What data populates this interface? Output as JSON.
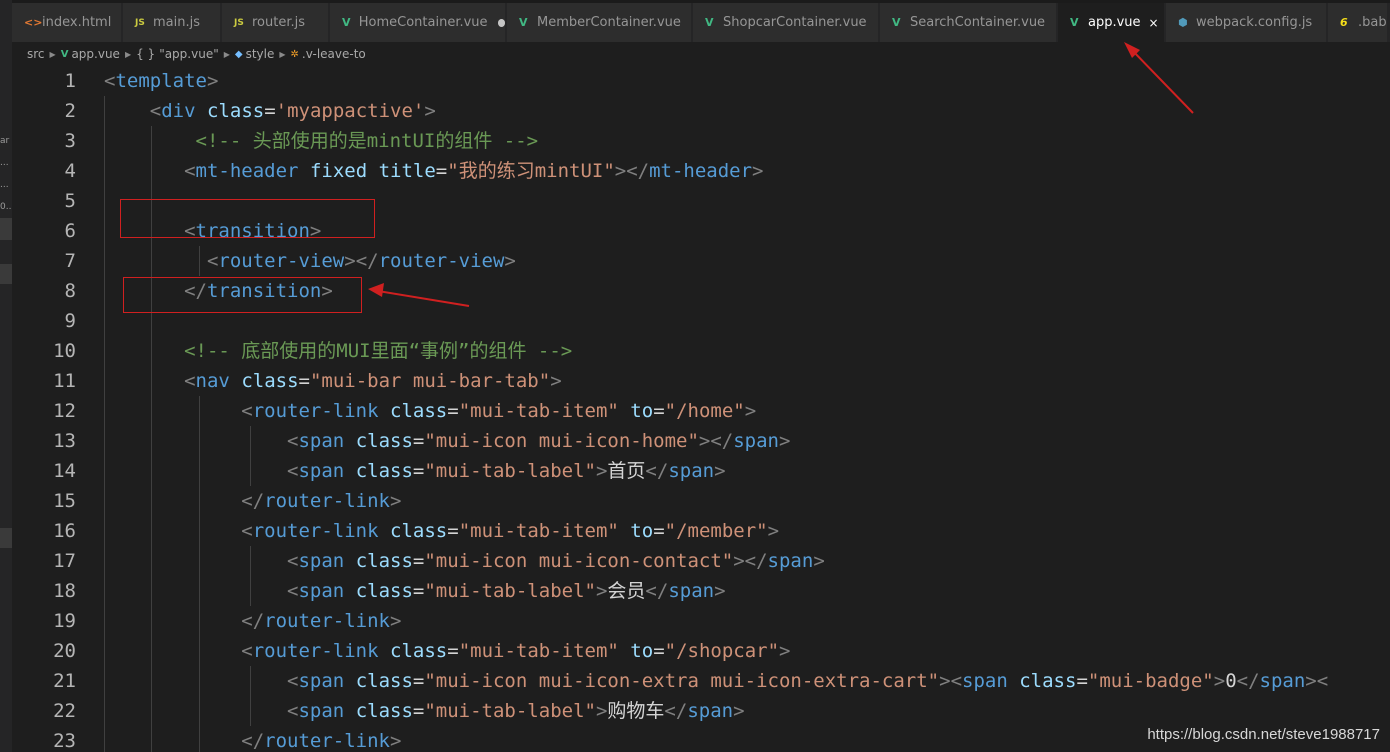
{
  "tabs": [
    {
      "label": "index.html",
      "icon": "html-icon",
      "state": "close"
    },
    {
      "label": "main.js",
      "icon": "js-icon",
      "state": ""
    },
    {
      "label": "router.js",
      "icon": "js-icon",
      "state": ""
    },
    {
      "label": "HomeContainer.vue",
      "icon": "vue-icon",
      "state": "dirty"
    },
    {
      "label": "MemberContainer.vue",
      "icon": "vue-icon",
      "state": ""
    },
    {
      "label": "ShopcarContainer.vue",
      "icon": "vue-icon",
      "state": ""
    },
    {
      "label": "SearchContainer.vue",
      "icon": "vue-icon",
      "state": ""
    },
    {
      "label": "app.vue",
      "icon": "vue-icon",
      "state": "active"
    },
    {
      "label": "webpack.config.js",
      "icon": "webpack-icon",
      "state": ""
    },
    {
      "label": ".bab",
      "icon": "babel-icon",
      "state": ""
    }
  ],
  "tab_glyphs": {
    "close": "×",
    "js": "JS",
    "html": "<>",
    "vue": "V",
    "webpack": "⬢",
    "babel": "6"
  },
  "breadcrumb": {
    "folder": "src",
    "file": "app.vue",
    "braces": "{ }",
    "module": "\"app.vue\"",
    "section": "style",
    "selector": ".v-leave-to",
    "sep": "▶"
  },
  "sidebar_fragments": [
    "ar",
    "...",
    "...",
    "0..."
  ],
  "code_lines": [
    {
      "n": "1",
      "tokens": [
        [
          "ang",
          "<"
        ],
        [
          "tag",
          "template"
        ],
        [
          "ang",
          ">"
        ]
      ]
    },
    {
      "n": "2",
      "tokens": [
        [
          "txt",
          "    "
        ],
        [
          "ang",
          "<"
        ],
        [
          "tag",
          "div"
        ],
        [
          "txt",
          " "
        ],
        [
          "attr",
          "class"
        ],
        [
          "eq",
          "="
        ],
        [
          "str",
          "'myappactive'"
        ],
        [
          "ang",
          ">"
        ]
      ]
    },
    {
      "n": "3",
      "tokens": [
        [
          "txt",
          "        "
        ],
        [
          "cmt",
          "<!-- 头部使用的是mintUI的组件 -->"
        ]
      ]
    },
    {
      "n": "4",
      "tokens": [
        [
          "txt",
          "       "
        ],
        [
          "ang",
          "<"
        ],
        [
          "tag",
          "mt-header"
        ],
        [
          "txt",
          " "
        ],
        [
          "attr",
          "fixed"
        ],
        [
          "txt",
          " "
        ],
        [
          "attr",
          "title"
        ],
        [
          "eq",
          "="
        ],
        [
          "str",
          "\"我的练习mintUI\""
        ],
        [
          "ang",
          "></"
        ],
        [
          "tag",
          "mt-header"
        ],
        [
          "ang",
          ">"
        ]
      ]
    },
    {
      "n": "5",
      "tokens": []
    },
    {
      "n": "6",
      "tokens": [
        [
          "txt",
          "       "
        ],
        [
          "ang",
          "<"
        ],
        [
          "tag",
          "transition"
        ],
        [
          "ang",
          ">"
        ]
      ]
    },
    {
      "n": "7",
      "tokens": [
        [
          "txt",
          "         "
        ],
        [
          "ang",
          "<"
        ],
        [
          "tag",
          "router-view"
        ],
        [
          "ang",
          "></"
        ],
        [
          "tag",
          "router-view"
        ],
        [
          "ang",
          ">"
        ]
      ]
    },
    {
      "n": "8",
      "tokens": [
        [
          "txt",
          "       "
        ],
        [
          "ang",
          "</"
        ],
        [
          "tag",
          "transition"
        ],
        [
          "ang",
          ">"
        ]
      ]
    },
    {
      "n": "9",
      "tokens": []
    },
    {
      "n": "10",
      "tokens": [
        [
          "txt",
          "       "
        ],
        [
          "cmt",
          "<!-- 底部使用的MUI里面“事例”的组件 -->"
        ]
      ]
    },
    {
      "n": "11",
      "tokens": [
        [
          "txt",
          "       "
        ],
        [
          "ang",
          "<"
        ],
        [
          "tag",
          "nav"
        ],
        [
          "txt",
          " "
        ],
        [
          "attr",
          "class"
        ],
        [
          "eq",
          "="
        ],
        [
          "str",
          "\"mui-bar mui-bar-tab\""
        ],
        [
          "ang",
          ">"
        ]
      ]
    },
    {
      "n": "12",
      "tokens": [
        [
          "txt",
          "            "
        ],
        [
          "ang",
          "<"
        ],
        [
          "tag",
          "router-link"
        ],
        [
          "txt",
          " "
        ],
        [
          "attr",
          "class"
        ],
        [
          "eq",
          "="
        ],
        [
          "str",
          "\"mui-tab-item\""
        ],
        [
          "txt",
          " "
        ],
        [
          "attr",
          "to"
        ],
        [
          "eq",
          "="
        ],
        [
          "str",
          "\"/home\""
        ],
        [
          "ang",
          ">"
        ]
      ]
    },
    {
      "n": "13",
      "tokens": [
        [
          "txt",
          "                "
        ],
        [
          "ang",
          "<"
        ],
        [
          "tag",
          "span"
        ],
        [
          "txt",
          " "
        ],
        [
          "attr",
          "class"
        ],
        [
          "eq",
          "="
        ],
        [
          "str",
          "\"mui-icon mui-icon-home\""
        ],
        [
          "ang",
          "></"
        ],
        [
          "tag",
          "span"
        ],
        [
          "ang",
          ">"
        ]
      ]
    },
    {
      "n": "14",
      "tokens": [
        [
          "txt",
          "                "
        ],
        [
          "ang",
          "<"
        ],
        [
          "tag",
          "span"
        ],
        [
          "txt",
          " "
        ],
        [
          "attr",
          "class"
        ],
        [
          "eq",
          "="
        ],
        [
          "str",
          "\"mui-tab-label\""
        ],
        [
          "ang",
          ">"
        ],
        [
          "txt",
          "首页"
        ],
        [
          "ang",
          "</"
        ],
        [
          "tag",
          "span"
        ],
        [
          "ang",
          ">"
        ]
      ]
    },
    {
      "n": "15",
      "tokens": [
        [
          "txt",
          "            "
        ],
        [
          "ang",
          "</"
        ],
        [
          "tag",
          "router-link"
        ],
        [
          "ang",
          ">"
        ]
      ]
    },
    {
      "n": "16",
      "tokens": [
        [
          "txt",
          "            "
        ],
        [
          "ang",
          "<"
        ],
        [
          "tag",
          "router-link"
        ],
        [
          "txt",
          " "
        ],
        [
          "attr",
          "class"
        ],
        [
          "eq",
          "="
        ],
        [
          "str",
          "\"mui-tab-item\""
        ],
        [
          "txt",
          " "
        ],
        [
          "attr",
          "to"
        ],
        [
          "eq",
          "="
        ],
        [
          "str",
          "\"/member\""
        ],
        [
          "ang",
          ">"
        ]
      ]
    },
    {
      "n": "17",
      "tokens": [
        [
          "txt",
          "                "
        ],
        [
          "ang",
          "<"
        ],
        [
          "tag",
          "span"
        ],
        [
          "txt",
          " "
        ],
        [
          "attr",
          "class"
        ],
        [
          "eq",
          "="
        ],
        [
          "str",
          "\"mui-icon mui-icon-contact\""
        ],
        [
          "ang",
          "></"
        ],
        [
          "tag",
          "span"
        ],
        [
          "ang",
          ">"
        ]
      ]
    },
    {
      "n": "18",
      "tokens": [
        [
          "txt",
          "                "
        ],
        [
          "ang",
          "<"
        ],
        [
          "tag",
          "span"
        ],
        [
          "txt",
          " "
        ],
        [
          "attr",
          "class"
        ],
        [
          "eq",
          "="
        ],
        [
          "str",
          "\"mui-tab-label\""
        ],
        [
          "ang",
          ">"
        ],
        [
          "txt",
          "会员"
        ],
        [
          "ang",
          "</"
        ],
        [
          "tag",
          "span"
        ],
        [
          "ang",
          ">"
        ]
      ]
    },
    {
      "n": "19",
      "tokens": [
        [
          "txt",
          "            "
        ],
        [
          "ang",
          "</"
        ],
        [
          "tag",
          "router-link"
        ],
        [
          "ang",
          ">"
        ]
      ]
    },
    {
      "n": "20",
      "tokens": [
        [
          "txt",
          "            "
        ],
        [
          "ang",
          "<"
        ],
        [
          "tag",
          "router-link"
        ],
        [
          "txt",
          " "
        ],
        [
          "attr",
          "class"
        ],
        [
          "eq",
          "="
        ],
        [
          "str",
          "\"mui-tab-item\""
        ],
        [
          "txt",
          " "
        ],
        [
          "attr",
          "to"
        ],
        [
          "eq",
          "="
        ],
        [
          "str",
          "\"/shopcar\""
        ],
        [
          "ang",
          ">"
        ]
      ]
    },
    {
      "n": "21",
      "tokens": [
        [
          "txt",
          "                "
        ],
        [
          "ang",
          "<"
        ],
        [
          "tag",
          "span"
        ],
        [
          "txt",
          " "
        ],
        [
          "attr",
          "class"
        ],
        [
          "eq",
          "="
        ],
        [
          "str",
          "\"mui-icon mui-icon-extra mui-icon-extra-cart\""
        ],
        [
          "ang",
          "><"
        ],
        [
          "tag",
          "span"
        ],
        [
          "txt",
          " "
        ],
        [
          "attr",
          "class"
        ],
        [
          "eq",
          "="
        ],
        [
          "str",
          "\"mui-badge\""
        ],
        [
          "ang",
          ">"
        ],
        [
          "txt",
          "0"
        ],
        [
          "ang",
          "</"
        ],
        [
          "tag",
          "span"
        ],
        [
          "ang",
          "><"
        ]
      ]
    },
    {
      "n": "22",
      "tokens": [
        [
          "txt",
          "                "
        ],
        [
          "ang",
          "<"
        ],
        [
          "tag",
          "span"
        ],
        [
          "txt",
          " "
        ],
        [
          "attr",
          "class"
        ],
        [
          "eq",
          "="
        ],
        [
          "str",
          "\"mui-tab-label\""
        ],
        [
          "ang",
          ">"
        ],
        [
          "txt",
          "购物车"
        ],
        [
          "ang",
          "</"
        ],
        [
          "tag",
          "span"
        ],
        [
          "ang",
          ">"
        ]
      ]
    },
    {
      "n": "23",
      "tokens": [
        [
          "txt",
          "            "
        ],
        [
          "ang",
          "</"
        ],
        [
          "tag",
          "router-link"
        ],
        [
          "ang",
          ">"
        ]
      ]
    }
  ],
  "watermark": "https://blog.csdn.net/steve1988717",
  "colors": {
    "editor_bg": "#1e1e1e",
    "tab_bg": "#2d2d2d",
    "tag": "#569cd6",
    "attr": "#9cdcfe",
    "string": "#ce9178",
    "comment": "#6a9955",
    "annotation": "#d02020"
  }
}
